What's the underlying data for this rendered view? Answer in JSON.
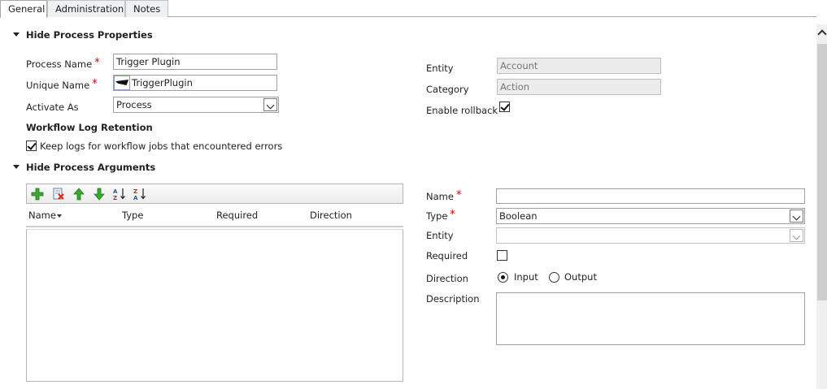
{
  "tabs": [
    "General",
    "Administration",
    "Notes"
  ],
  "process_properties": {
    "section_title": "Hide Process Properties",
    "process_name_label": "Process Name",
    "process_name_value": "Trigger Plugin",
    "unique_name_label": "Unique Name",
    "unique_name_value": "TriggerPlugin",
    "activate_as_label": "Activate As",
    "activate_as_value": "Process",
    "entity_label": "Entity",
    "entity_value": "Account",
    "category_label": "Category",
    "category_value": "Action",
    "enable_rollback_label": "Enable rollback",
    "enable_rollback_checked": true,
    "log_retention_title": "Workflow Log Retention",
    "keep_logs_label": "Keep logs for workflow jobs that encountered errors",
    "keep_logs_checked": true,
    "required_marker": "*"
  },
  "process_arguments": {
    "section_title": "Hide Process Arguments",
    "toolbar_icons": [
      "add-icon",
      "delete-icon",
      "move-up-icon",
      "move-down-icon",
      "sort-ascending-icon",
      "sort-descending-icon"
    ],
    "columns": [
      "Name",
      "Type",
      "Required",
      "Direction"
    ],
    "rows": [],
    "form": {
      "name_label": "Name",
      "name_value": "",
      "type_label": "Type",
      "type_value": "Boolean",
      "entity_label": "Entity",
      "entity_value": "",
      "required_label": "Required",
      "required_checked": false,
      "direction_label": "Direction",
      "direction_options": [
        "Input",
        "Output"
      ],
      "direction_selected": "Input",
      "description_label": "Description",
      "description_value": ""
    }
  }
}
